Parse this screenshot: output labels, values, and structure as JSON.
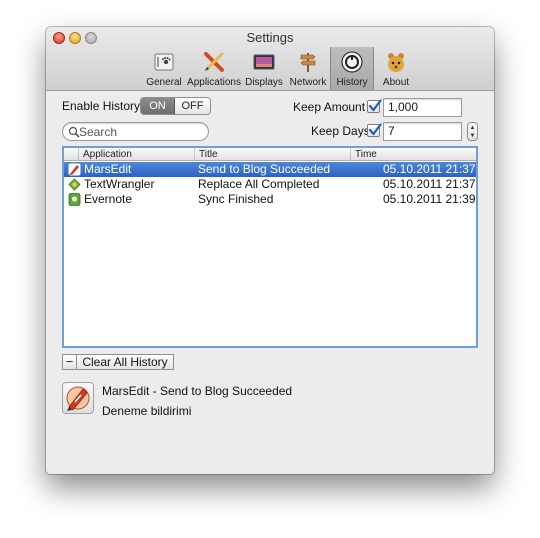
{
  "window": {
    "title": "Settings"
  },
  "toolbar": {
    "items": [
      {
        "label": "General",
        "icon": "general-icon"
      },
      {
        "label": "Applications",
        "icon": "applications-icon"
      },
      {
        "label": "Displays",
        "icon": "displays-icon"
      },
      {
        "label": "Network",
        "icon": "network-icon"
      },
      {
        "label": "History",
        "icon": "history-icon",
        "selected": true
      },
      {
        "label": "About",
        "icon": "about-icon"
      }
    ]
  },
  "history": {
    "enable_label": "Enable History:",
    "toggle": {
      "on": "ON",
      "off": "OFF",
      "selected": "ON"
    },
    "keep_amount_label": "Keep Amount",
    "keep_amount_checked": true,
    "keep_amount_value": "1,000",
    "keep_days_label": "Keep Days",
    "keep_days_checked": true,
    "keep_days_value": "7",
    "search_placeholder": "Search"
  },
  "table": {
    "columns": [
      "Application",
      "Title",
      "Time"
    ],
    "rows": [
      {
        "application": "MarsEdit",
        "title": "Send to Blog Succeeded",
        "time": "05.10.2011 21:37",
        "icon": "marsedit-icon",
        "selected": true
      },
      {
        "application": "TextWrangler",
        "title": "Replace All Completed",
        "time": "05.10.2011 21:37",
        "icon": "textwrangler-icon",
        "selected": false
      },
      {
        "application": "Evernote",
        "title": "Sync Finished",
        "time": "05.10.2011 21:39",
        "icon": "evernote-icon",
        "selected": false
      }
    ]
  },
  "actions": {
    "remove_label": "−",
    "clear_label": "Clear All History"
  },
  "preview": {
    "title": "MarsEdit - Send to Blog Succeeded",
    "description": "Deneme bildirimi",
    "icon": "marsedit-icon"
  },
  "colors": {
    "selection": "#3a74d0",
    "table_border": "#6f9ed8",
    "check_mark": "#2a5fb8"
  }
}
